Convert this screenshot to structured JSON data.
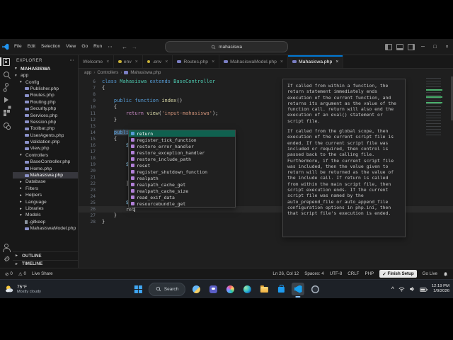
{
  "icons": {
    "close": "×",
    "chevron_down": "▾",
    "chevron_right": "▸",
    "chevron_up": "^",
    "breadcrumb_sep": "›",
    "back": "←",
    "forward": "→",
    "ellipsis": "⋯",
    "check": "✓",
    "error": "⊘",
    "warning": "⚠",
    "minimize": "─",
    "maximize": "□",
    "settings_gear": "⚙"
  },
  "titlebar": {
    "menus": [
      "File",
      "Edit",
      "Selection",
      "View",
      "Go",
      "Run",
      "⋯"
    ],
    "search_value": "mahasiswa"
  },
  "activity_bar": {
    "top": [
      {
        "name": "explorer",
        "active": true
      },
      {
        "name": "search"
      },
      {
        "name": "source-control"
      },
      {
        "name": "run-and-debug"
      },
      {
        "name": "extensions"
      },
      {
        "name": "live-share"
      }
    ],
    "bottom": [
      {
        "name": "account"
      },
      {
        "name": "settings",
        "glyph": "⚙"
      }
    ]
  },
  "explorer": {
    "header": "EXPLORER",
    "root": "MAHASISWA",
    "tree": [
      {
        "label": "app",
        "depth": 0,
        "type": "folder",
        "expanded": true
      },
      {
        "label": "Config",
        "depth": 1,
        "type": "folder",
        "expanded": true
      },
      {
        "label": "Publisher.php",
        "depth": 2,
        "type": "php"
      },
      {
        "label": "Routes.php",
        "depth": 2,
        "type": "php"
      },
      {
        "label": "Routing.php",
        "depth": 2,
        "type": "php"
      },
      {
        "label": "Security.php",
        "depth": 2,
        "type": "php"
      },
      {
        "label": "Services.php",
        "depth": 2,
        "type": "php"
      },
      {
        "label": "Session.php",
        "depth": 2,
        "type": "php"
      },
      {
        "label": "Toolbar.php",
        "depth": 2,
        "type": "php"
      },
      {
        "label": "UserAgents.php",
        "depth": 2,
        "type": "php"
      },
      {
        "label": "Validation.php",
        "depth": 2,
        "type": "php"
      },
      {
        "label": "View.php",
        "depth": 2,
        "type": "php"
      },
      {
        "label": "Controllers",
        "depth": 1,
        "type": "folder",
        "expanded": true
      },
      {
        "label": "BaseController.php",
        "depth": 2,
        "type": "php"
      },
      {
        "label": "Home.php",
        "depth": 2,
        "type": "php"
      },
      {
        "label": "Mahasiswa.php",
        "depth": 2,
        "type": "php",
        "selected": true
      },
      {
        "label": "Database",
        "depth": 1,
        "type": "folder"
      },
      {
        "label": "Filters",
        "depth": 1,
        "type": "folder"
      },
      {
        "label": "Helpers",
        "depth": 1,
        "type": "folder"
      },
      {
        "label": "Language",
        "depth": 1,
        "type": "folder"
      },
      {
        "label": "Libraries",
        "depth": 1,
        "type": "folder"
      },
      {
        "label": "Models",
        "depth": 1,
        "type": "folder",
        "expanded": true
      },
      {
        "label": ".gitkeep",
        "depth": 2,
        "type": "file"
      },
      {
        "label": "MahasiswaModel.php",
        "depth": 2,
        "type": "php"
      }
    ],
    "sections": [
      "OUTLINE",
      "TIMELINE"
    ]
  },
  "tabs": [
    {
      "label": "Welcome"
    },
    {
      "label": "env",
      "icon": "gear"
    },
    {
      "label": ".env",
      "icon": "gear"
    },
    {
      "label": "Routes.php",
      "icon": "php"
    },
    {
      "label": "MahasiswaModel.php",
      "icon": "php"
    },
    {
      "label": "Mahasiswa.php",
      "icon": "php",
      "active": true
    }
  ],
  "breadcrumb": [
    "app",
    "Controllers",
    "Mahasiswa.php"
  ],
  "editor": {
    "lines": [
      {
        "n": 6,
        "tokens": [
          [
            "kw",
            "class "
          ],
          [
            "type",
            "Mahasiswa "
          ],
          [
            "kw",
            "extends "
          ],
          [
            "type",
            "BaseController"
          ]
        ]
      },
      {
        "n": 7,
        "tokens": [
          [
            "pln",
            "{"
          ]
        ]
      },
      {
        "n": 8,
        "tokens": []
      },
      {
        "n": 9,
        "tokens": [
          [
            "pln",
            "    "
          ],
          [
            "kw",
            "public "
          ],
          [
            "kw",
            "function "
          ],
          [
            "fn",
            "index"
          ],
          [
            "pln",
            "()"
          ]
        ]
      },
      {
        "n": 10,
        "tokens": [
          [
            "pln",
            "    {"
          ]
        ]
      },
      {
        "n": 11,
        "tokens": [
          [
            "pln",
            "        "
          ],
          [
            "ctl",
            "return "
          ],
          [
            "fn",
            "view"
          ],
          [
            "pln",
            "("
          ],
          [
            "str",
            "'input-mahasiswa'"
          ],
          [
            "pln",
            ");"
          ]
        ]
      },
      {
        "n": 12,
        "tokens": [
          [
            "pln",
            "    }"
          ]
        ]
      },
      {
        "n": 13,
        "tokens": []
      },
      {
        "n": 14,
        "tokens": [
          [
            "pln",
            "    "
          ],
          [
            "kwhl",
            "public"
          ]
        ]
      },
      {
        "n": 15,
        "tokens": [
          [
            "pln",
            "    {"
          ]
        ]
      },
      {
        "n": 16,
        "tokens": [
          [
            "pln",
            "        "
          ],
          [
            "var",
            "$mo"
          ]
        ]
      },
      {
        "n": 17,
        "tokens": []
      },
      {
        "n": 18,
        "tokens": []
      },
      {
        "n": 19,
        "tokens": [
          [
            "pln",
            "        "
          ],
          [
            "var",
            "$da"
          ]
        ]
      },
      {
        "n": 20,
        "tokens": []
      },
      {
        "n": 21,
        "tokens": []
      },
      {
        "n": 22,
        "tokens": [
          [
            "pln",
            "        ];"
          ]
        ]
      },
      {
        "n": 23,
        "tokens": []
      },
      {
        "n": 24,
        "tokens": []
      },
      {
        "n": 25,
        "tokens": [
          [
            "pln",
            "        "
          ],
          [
            "var",
            "$mo"
          ]
        ]
      },
      {
        "n": 26,
        "tokens": [
          [
            "pln",
            "        "
          ],
          [
            "pln",
            "ret"
          ]
        ],
        "cursor": true
      },
      {
        "n": 27,
        "tokens": [
          [
            "pln",
            "    }"
          ]
        ]
      },
      {
        "n": 28,
        "tokens": [
          [
            "pln",
            "}"
          ]
        ]
      }
    ]
  },
  "suggest": {
    "items": [
      {
        "label": "return",
        "kind": "keyword",
        "selected": true
      },
      {
        "label": "register_tick_function",
        "kind": "function"
      },
      {
        "label": "restore_error_handler",
        "kind": "function"
      },
      {
        "label": "restore_exception_handler",
        "kind": "function"
      },
      {
        "label": "restore_include_path",
        "kind": "function"
      },
      {
        "label": "reset",
        "kind": "function"
      },
      {
        "label": "register_shutdown_function",
        "kind": "function"
      },
      {
        "label": "realpath",
        "kind": "function"
      },
      {
        "label": "realpath_cache_get",
        "kind": "function"
      },
      {
        "label": "realpath_cache_size",
        "kind": "function"
      },
      {
        "label": "read_exif_data",
        "kind": "function"
      },
      {
        "label": "resourcebundle_get",
        "kind": "function"
      }
    ]
  },
  "docs": {
    "paragraphs": [
      "If called from within a function, the return statement immediately ends execution of the current function, and returns its argument as the value of the function call. return will also end the execution of an eval() statement or script file.",
      "If called from the global scope, then execution of the current script file is ended. If the current script file was included or required, then control is passed back to the calling file. Furthermore, if the current script file was included, then the value given to return will be returned as the value of the include call. If return is called from within the main script file, then script execution ends. If the current script file was named by the auto_prepend_file or auto_append_file configuration options in php.ini, then that script file's execution is ended."
    ]
  },
  "status_bar": {
    "left": [
      {
        "name": "problems-errors",
        "icon": "error",
        "text": "0"
      },
      {
        "name": "problems-warnings",
        "icon": "warning",
        "text": "0"
      },
      {
        "name": "live-share",
        "text": "Live Share"
      }
    ],
    "right": [
      {
        "name": "cursor-position",
        "text": "Ln 26, Col 12"
      },
      {
        "name": "indentation",
        "text": "Spaces: 4"
      },
      {
        "name": "encoding",
        "text": "UTF-8"
      },
      {
        "name": "eol-sequence",
        "text": "CRLF"
      },
      {
        "name": "language-mode",
        "text": "PHP"
      },
      {
        "name": "finish-setup",
        "icon": "check",
        "text": "Finish Setup",
        "highlight": true
      },
      {
        "name": "go-live",
        "text": "Go Live"
      },
      {
        "name": "notifications",
        "icon": "bell"
      }
    ]
  },
  "taskbar": {
    "weather": {
      "temp": "75°F",
      "condition": "Mostly cloudy"
    },
    "search_label": "Search",
    "apps": [
      {
        "name": "start"
      },
      {
        "name": "search"
      },
      {
        "name": "widgets"
      },
      {
        "name": "chat"
      },
      {
        "name": "copilot"
      },
      {
        "name": "edge"
      },
      {
        "name": "file-explorer"
      },
      {
        "name": "store"
      },
      {
        "name": "vscode",
        "active": true
      },
      {
        "name": "screen-recorder"
      }
    ],
    "clock": {
      "time": "12:19 PM",
      "date": "1/9/2026"
    }
  }
}
